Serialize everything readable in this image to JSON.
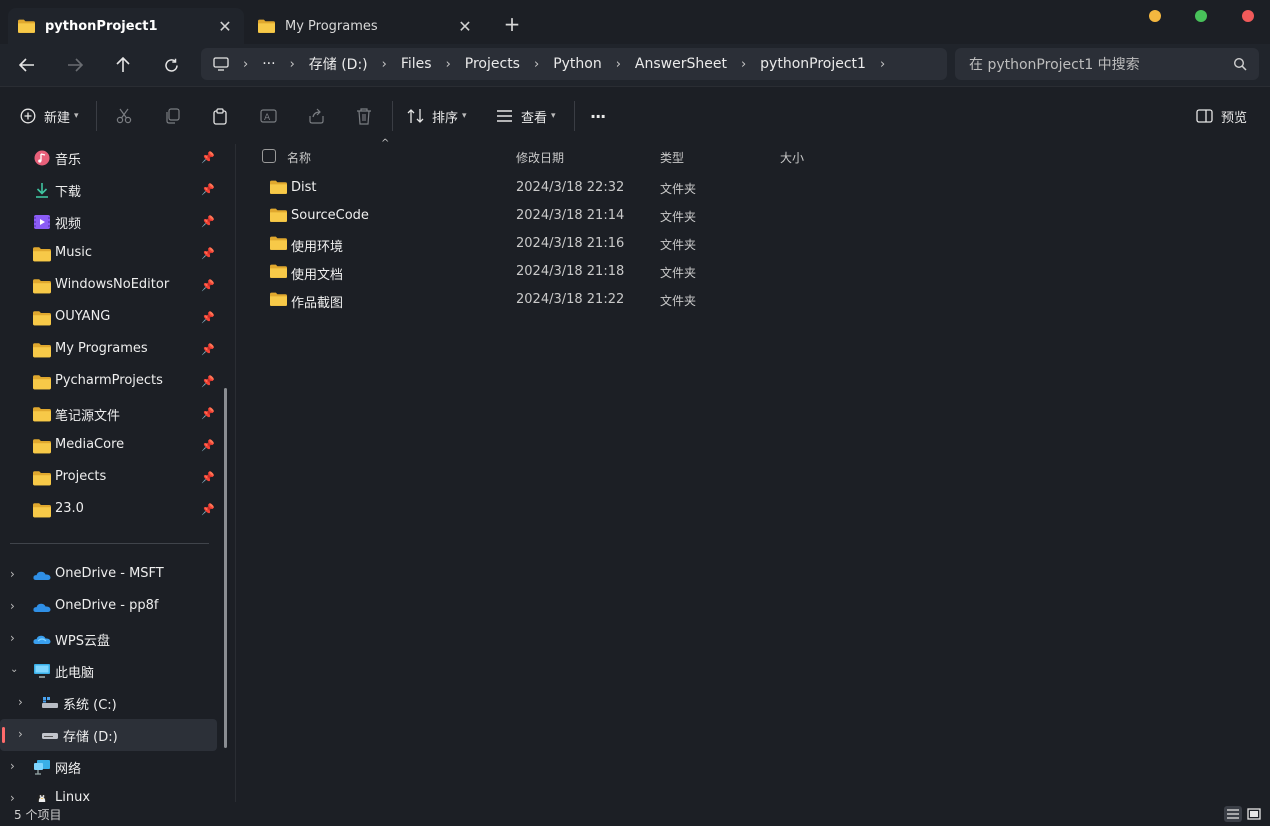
{
  "tabs": [
    {
      "label": "pythonProject1",
      "active": true
    },
    {
      "label": "My Programes",
      "active": false
    }
  ],
  "new_tab_symbol": "+",
  "close_symbol": "✕",
  "window_controls": {
    "minimize_color": "#f4b73f",
    "maximize_color": "#48c15a",
    "close_color": "#f05a5a"
  },
  "breadcrumbs": [
    "···",
    "存储 (D:)",
    "Files",
    "Projects",
    "Python",
    "AnswerSheet",
    "pythonProject1"
  ],
  "search": {
    "placeholder": "在 pythonProject1 中搜索"
  },
  "toolbar": {
    "new_label": "新建",
    "sort_label": "排序",
    "view_label": "查看",
    "more_label": "···",
    "preview_label": "预览"
  },
  "sidebar": {
    "pinned": [
      {
        "label": "音乐",
        "icon": "music-icon"
      },
      {
        "label": "下载",
        "icon": "download-icon"
      },
      {
        "label": "视频",
        "icon": "video-icon"
      },
      {
        "label": "Music",
        "icon": "folder-icon"
      },
      {
        "label": "WindowsNoEditor",
        "icon": "folder-icon"
      },
      {
        "label": "OUYANG",
        "icon": "folder-icon"
      },
      {
        "label": "My Programes",
        "icon": "folder-icon"
      },
      {
        "label": "PycharmProjects",
        "icon": "folder-icon"
      },
      {
        "label": "笔记源文件",
        "icon": "folder-icon"
      },
      {
        "label": "MediaCore",
        "icon": "folder-icon"
      },
      {
        "label": "Projects",
        "icon": "folder-icon"
      },
      {
        "label": "23.0",
        "icon": "folder-icon"
      }
    ],
    "tree": [
      {
        "label": "OneDrive - MSFT",
        "icon": "onedrive-icon",
        "level": 0
      },
      {
        "label": "OneDrive - pp8f",
        "icon": "onedrive-icon",
        "level": 0
      },
      {
        "label": "WPS云盘",
        "icon": "wps-cloud-icon",
        "level": 0
      },
      {
        "label": "此电脑",
        "icon": "computer-icon",
        "level": 0,
        "expanded": true
      },
      {
        "label": "系统 (C:)",
        "icon": "drive-c-icon",
        "level": 1
      },
      {
        "label": "存储 (D:)",
        "icon": "drive-icon",
        "level": 1,
        "selected": true
      },
      {
        "label": "网络",
        "icon": "network-icon",
        "level": 0
      },
      {
        "label": "Linux",
        "icon": "linux-icon",
        "level": 0
      }
    ]
  },
  "columns": {
    "name": "名称",
    "date": "修改日期",
    "type": "类型",
    "size": "大小"
  },
  "files": [
    {
      "name": "Dist",
      "date": "2024/3/18 22:32",
      "type": "文件夹"
    },
    {
      "name": "SourceCode",
      "date": "2024/3/18 21:14",
      "type": "文件夹"
    },
    {
      "name": "使用环境",
      "date": "2024/3/18 21:16",
      "type": "文件夹"
    },
    {
      "name": "使用文档",
      "date": "2024/3/18 21:18",
      "type": "文件夹"
    },
    {
      "name": "作品截图",
      "date": "2024/3/18 21:22",
      "type": "文件夹"
    }
  ],
  "status": {
    "item_count": "5 个项目"
  }
}
